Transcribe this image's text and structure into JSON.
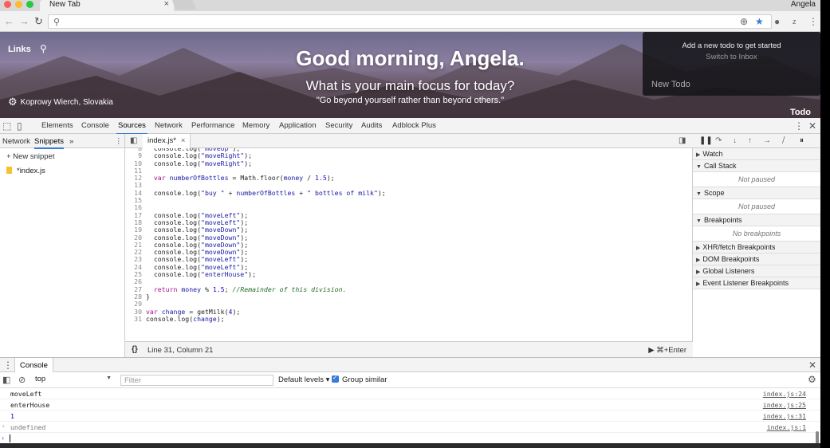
{
  "browser": {
    "tab_title": "New Tab",
    "tab_close": "×",
    "profile_name": "Angela"
  },
  "newtab": {
    "links_label": "Links",
    "greeting": "Good morning, Angela.",
    "focus_question": "What is your main focus for today?",
    "quote": "\"Go beyond yourself rather than beyond others.\"",
    "location": "Koprowy Wierch, Slovakia",
    "todo_add": "Add a new todo to get started",
    "todo_switch": "Switch to Inbox",
    "todo_placeholder": "New Todo",
    "todo_label": "Todo"
  },
  "devtools": {
    "tabs": [
      "Elements",
      "Console",
      "Sources",
      "Network",
      "Performance",
      "Memory",
      "Application",
      "Security",
      "Audits",
      "Adblock Plus"
    ],
    "active_tab": "Sources",
    "navigator": {
      "tabs": [
        "Network",
        "Snippets"
      ],
      "active_tab": "Snippets",
      "new_snippet": "+ New snippet",
      "file": "*index.js"
    },
    "editor": {
      "tab_label": "index.js*",
      "tab_close": "×",
      "lines": [
        {
          "n": "8",
          "code": "  console.log(\"moveUp\");"
        },
        {
          "n": "9",
          "code": "  console.log(\"moveRight\");"
        },
        {
          "n": "10",
          "code": "  console.log(\"moveRight\");"
        },
        {
          "n": "11",
          "code": ""
        },
        {
          "n": "12",
          "code": "  var numberOfBottles = Math.floor(money / 1.5);"
        },
        {
          "n": "13",
          "code": ""
        },
        {
          "n": "14",
          "code": "  console.log(\"buy \" + numberOfBottles + \" bottles of milk\");"
        },
        {
          "n": "15",
          "code": ""
        },
        {
          "n": "16",
          "code": ""
        },
        {
          "n": "17",
          "code": "  console.log(\"moveLeft\");"
        },
        {
          "n": "18",
          "code": "  console.log(\"moveLeft\");"
        },
        {
          "n": "19",
          "code": "  console.log(\"moveDown\");"
        },
        {
          "n": "20",
          "code": "  console.log(\"moveDown\");"
        },
        {
          "n": "21",
          "code": "  console.log(\"moveDown\");"
        },
        {
          "n": "22",
          "code": "  console.log(\"moveDown\");"
        },
        {
          "n": "23",
          "code": "  console.log(\"moveLeft\");"
        },
        {
          "n": "24",
          "code": "  console.log(\"moveLeft\");"
        },
        {
          "n": "25",
          "code": "  console.log(\"enterHouse\");"
        },
        {
          "n": "26",
          "code": ""
        },
        {
          "n": "27",
          "code": "  return money % 1.5; //Remainder of this division."
        },
        {
          "n": "28",
          "code": "}"
        },
        {
          "n": "29",
          "code": ""
        },
        {
          "n": "30",
          "code": "var change = getMilk(4);"
        },
        {
          "n": "31",
          "code": "console.log(change);"
        }
      ],
      "status_braces": "{}",
      "cursor_position": "Line 31, Column 21",
      "run_label": "▶ ⌘+Enter"
    },
    "debugger": {
      "watch": "Watch",
      "call_stack": "Call Stack",
      "call_stack_body": "Not paused",
      "scope": "Scope",
      "scope_body": "Not paused",
      "breakpoints": "Breakpoints",
      "breakpoints_body": "No breakpoints",
      "xhr": "XHR/fetch Breakpoints",
      "dom": "DOM Breakpoints",
      "global": "Global Listeners",
      "event": "Event Listener Breakpoints"
    }
  },
  "console": {
    "tab_label": "Console",
    "context": "top",
    "filter_placeholder": "Filter",
    "levels": "Default levels ▾",
    "group_similar": "Group similar",
    "messages": [
      {
        "text": "moveLeft",
        "src": "index.js:24"
      },
      {
        "text": "enterHouse",
        "src": "index.js:25"
      },
      {
        "text": "1",
        "src": "index.js:31"
      },
      {
        "text": "undefined",
        "src": "index.js:1"
      }
    ]
  }
}
